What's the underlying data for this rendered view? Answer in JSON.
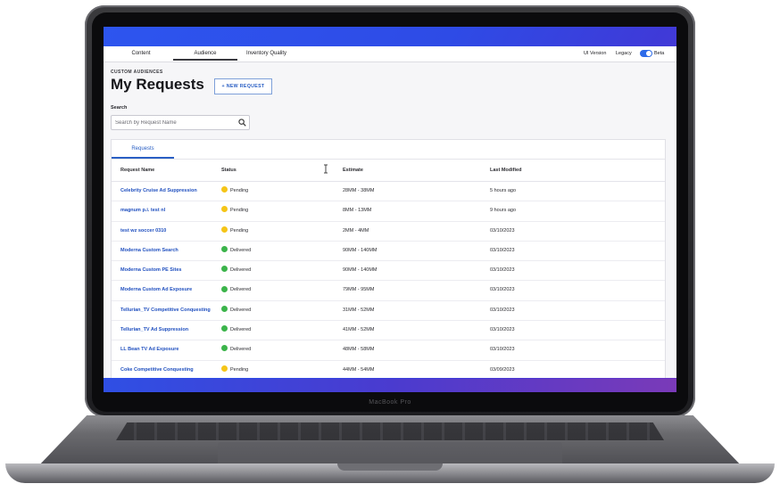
{
  "device": {
    "model_label": "MacBook Pro"
  },
  "nav": {
    "tabs": [
      {
        "label": "Content",
        "active": false
      },
      {
        "label": "Audience",
        "active": true
      },
      {
        "label": "Inventory Quality",
        "active": false
      }
    ],
    "ui_version_label": "UI Version",
    "legacy_label": "Legacy",
    "beta_label": "Beta",
    "toggle_on": true
  },
  "page": {
    "eyebrow": "CUSTOM AUDIENCES",
    "title": "My Requests",
    "new_request_label": "+ NEW REQUEST"
  },
  "search": {
    "label": "Search",
    "placeholder": "Search by Request Name",
    "value": ""
  },
  "card": {
    "tab_label": "Requests",
    "columns": {
      "name": "Request Name",
      "status": "Status",
      "estimate": "Estimate",
      "modified": "Last Modified"
    },
    "rows": [
      {
        "name": "Celebrity Cruise Ad Suppression",
        "status": "Pending",
        "estimate": "28MM - 38MM",
        "modified": "5 hours ago"
      },
      {
        "name": "magnum p.i. test nl",
        "status": "Pending",
        "estimate": "8MM - 13MM",
        "modified": "9 hours ago"
      },
      {
        "name": "test wz soccer 0310",
        "status": "Pending",
        "estimate": "2MM - 4MM",
        "modified": "03/10/2023"
      },
      {
        "name": "Moderna Custom Search",
        "status": "Delivered",
        "estimate": "90MM - 140MM",
        "modified": "03/10/2023"
      },
      {
        "name": "Moderna Custom PE Sites",
        "status": "Delivered",
        "estimate": "90MM - 140MM",
        "modified": "03/10/2023"
      },
      {
        "name": "Moderna Custom Ad Exposure",
        "status": "Delivered",
        "estimate": "79MM - 95MM",
        "modified": "03/10/2023"
      },
      {
        "name": "Tellurian_TV Competitive Conquesting",
        "status": "Delivered",
        "estimate": "31MM - 52MM",
        "modified": "03/10/2023"
      },
      {
        "name": "Tellurian_TV Ad Suppression",
        "status": "Delivered",
        "estimate": "41MM - 52MM",
        "modified": "03/10/2023"
      },
      {
        "name": "LL Bean TV Ad Exposure",
        "status": "Delivered",
        "estimate": "48MM - 58MM",
        "modified": "03/10/2023"
      },
      {
        "name": "Coke Competitive Conquesting",
        "status": "Pending",
        "estimate": "44MM - 54MM",
        "modified": "03/09/2023"
      }
    ]
  },
  "colors": {
    "pending": "#f5c518",
    "delivered": "#3cb44b",
    "accent": "#2a5fc4"
  }
}
